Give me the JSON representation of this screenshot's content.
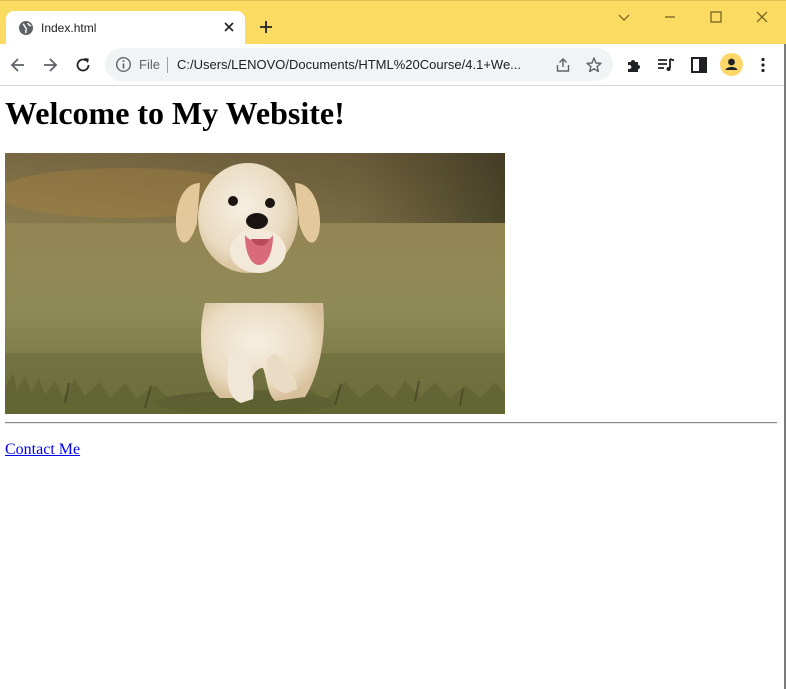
{
  "browser": {
    "tab": {
      "title": "Index.html"
    },
    "omnibox": {
      "scheme_label": "File",
      "url": "C:/Users/LENOVO/Documents/HTML%20Course/4.1+We..."
    },
    "accent_color": "#fcdb62",
    "icons": [
      "globe-icon",
      "close-icon",
      "plus-icon",
      "chevron-down-icon",
      "minimize-icon",
      "maximize-icon",
      "close-window-icon",
      "back-arrow-icon",
      "forward-arrow-icon",
      "reload-icon",
      "info-icon",
      "share-icon",
      "star-icon",
      "puzzle-icon",
      "media-queue-icon",
      "side-panel-icon",
      "profile-icon",
      "kebab-menu-icon"
    ]
  },
  "page": {
    "heading": "Welcome to My Website!",
    "image": {
      "subject": "golden retriever puppy running on grass"
    },
    "link": {
      "label": "Contact Me",
      "color": "#0000ee"
    }
  }
}
